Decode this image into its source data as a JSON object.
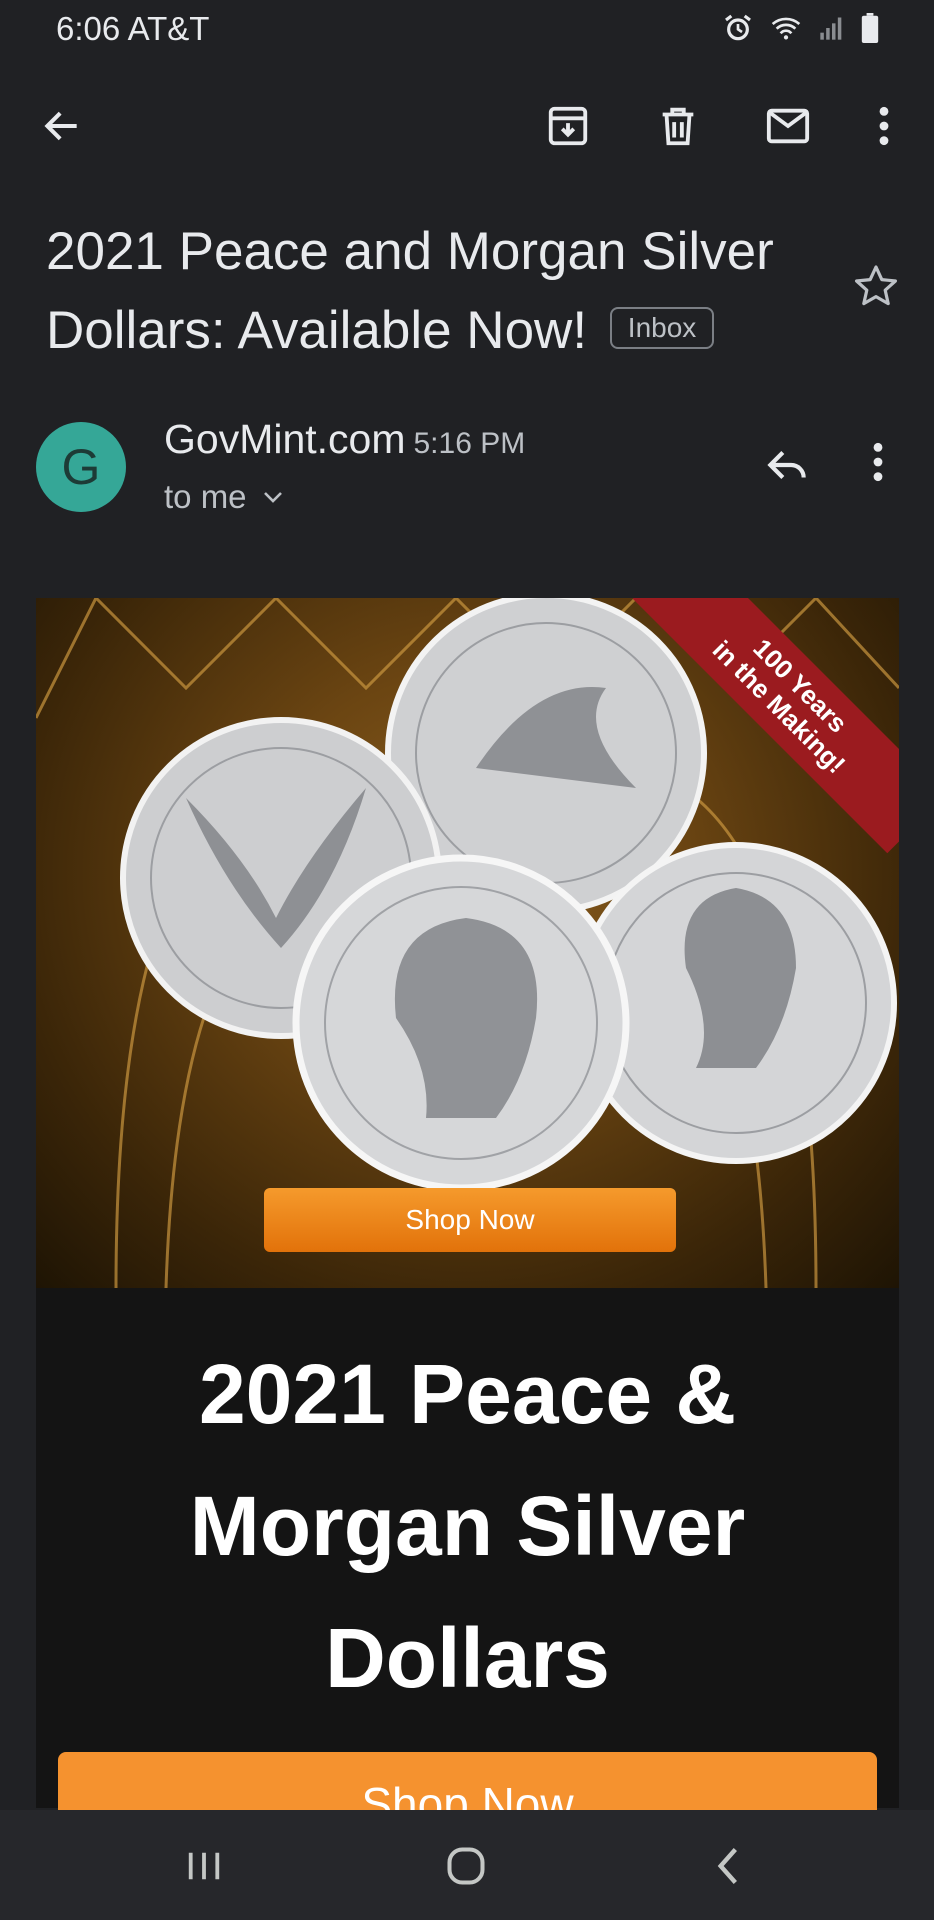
{
  "status_bar": {
    "time_carrier": "6:06 AT&T"
  },
  "toolbar": {
    "back_icon": "arrow-left-icon",
    "archive_icon": "archive-icon",
    "delete_icon": "trash-icon",
    "unread_icon": "mail-icon",
    "more_icon": "more-vert-icon"
  },
  "email": {
    "subject": "2021 Peace and Morgan Silver Dollars: Available Now!",
    "label": "Inbox",
    "sender_initial": "G",
    "sender": "GovMint.com",
    "time": "5:16 PM",
    "recipient": "to me"
  },
  "body": {
    "ribbon_line1": "100 Years",
    "ribbon_line2": "in the Making!",
    "hero_button": "Shop Now",
    "headline_line1": "2021 Peace &",
    "headline_line2": "Morgan Silver",
    "headline_line3": "Dollars",
    "bottom_button": "Shop Now"
  },
  "colors": {
    "background": "#202124",
    "avatar": "#35a797",
    "ribbon": "#9b1b1f",
    "button_orange": "#f5922f"
  }
}
